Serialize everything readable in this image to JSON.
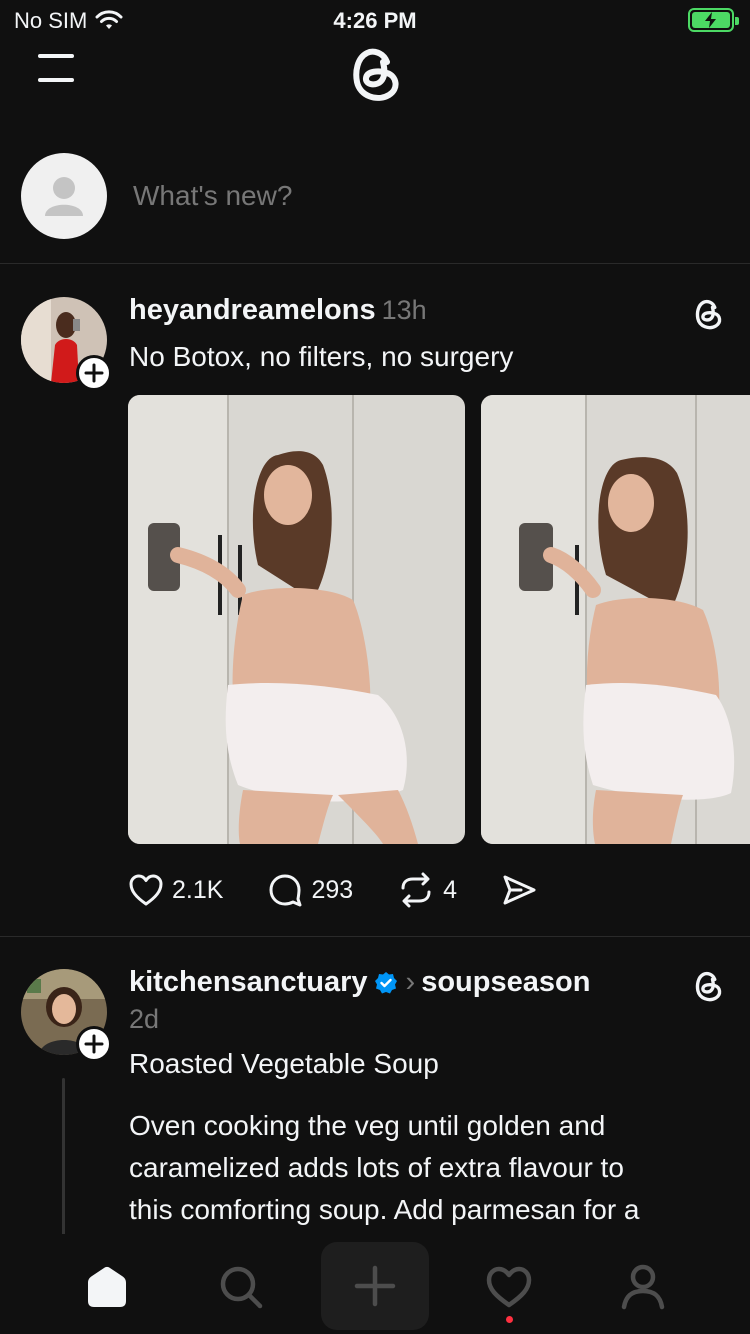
{
  "status_bar": {
    "carrier": "No SIM",
    "time": "4:26 PM",
    "icons": [
      "wifi-icon",
      "battery-charging-icon"
    ],
    "battery_color": "#4cd964"
  },
  "header": {
    "menu_icon": "hamburger-menu-icon",
    "logo_icon": "threads-logo-icon"
  },
  "composer": {
    "placeholder": "What's new?",
    "avatar_icon": "default-avatar-icon"
  },
  "posts": [
    {
      "username": "heyandreamelons",
      "time": "13h",
      "text": "No Botox, no filters, no surgery",
      "media_count": 2,
      "stats": {
        "likes": "2.1K",
        "replies": "293",
        "reposts": "4"
      }
    },
    {
      "username": "kitchensanctuary",
      "verified": true,
      "topic": "soupseason",
      "time": "2d",
      "title": "Roasted Vegetable Soup",
      "body_lines": [
        "Oven cooking the veg until golden and",
        "caramelized adds lots of extra flavour to",
        "this comforting soup. Add parmesan for a"
      ]
    }
  ],
  "tabbar": {
    "items": [
      "home-icon",
      "search-icon",
      "create-icon",
      "activity-icon",
      "profile-icon"
    ],
    "active": "home-icon",
    "notification_dot_color": "#ff3040"
  },
  "colors": {
    "background": "#101010",
    "text_primary": "#f3f5f7",
    "text_secondary": "#777777",
    "verified_blue": "#0095f6"
  }
}
